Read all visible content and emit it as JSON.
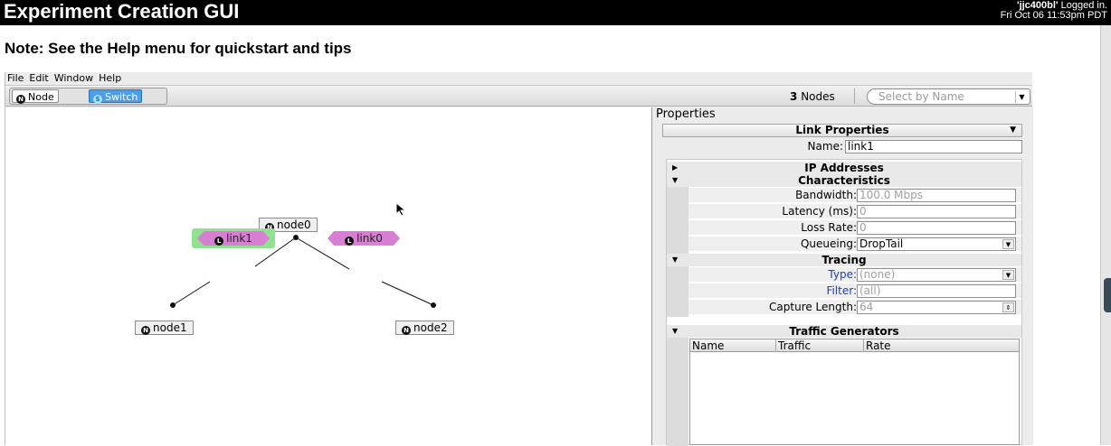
{
  "header": {
    "title": "Experiment Creation GUI",
    "user": "'jjc400bl'",
    "logged_in": "Logged in.",
    "datetime": "Fri Oct 06 11:53pm PDT"
  },
  "note": "Note: See the Help menu for quickstart and tips",
  "menu": [
    "File",
    "Edit",
    "Window",
    "Help"
  ],
  "toolbar": {
    "node_label": "Node",
    "switch_label": "Switch",
    "node_count": "3",
    "node_count_label": "Nodes",
    "select_placeholder": "Select by Name"
  },
  "canvas": {
    "nodes": {
      "node0": "node0",
      "node1": "node1",
      "node2": "node2"
    },
    "links": {
      "link1": "link1",
      "link0": "link0"
    }
  },
  "properties": {
    "title": "Properties",
    "panel": "Link Properties",
    "name_label": "Name:",
    "name_value": "link1",
    "sections": {
      "ip": "IP Addresses",
      "characteristics": "Characteristics",
      "tracing": "Tracing",
      "traffic": "Traffic Generators"
    },
    "bandwidth_label": "Bandwidth:",
    "bandwidth_value": "100.0 Mbps",
    "latency_label": "Latency (ms):",
    "latency_value": "0",
    "loss_label": "Loss Rate:",
    "loss_value": "0",
    "queueing_label": "Queueing:",
    "queueing_value": "DropTail",
    "type_label": "Type:",
    "type_value": "(none)",
    "filter_label": "Filter:",
    "filter_value": "(all)",
    "capture_label": "Capture Length:",
    "capture_value": "64",
    "traffic_columns": [
      "Name",
      "Traffic",
      "Rate"
    ]
  },
  "colors": {
    "link": "#d77fd0",
    "selected_highlight": "#8fe38f",
    "switch_button": "#4d9ee6"
  }
}
